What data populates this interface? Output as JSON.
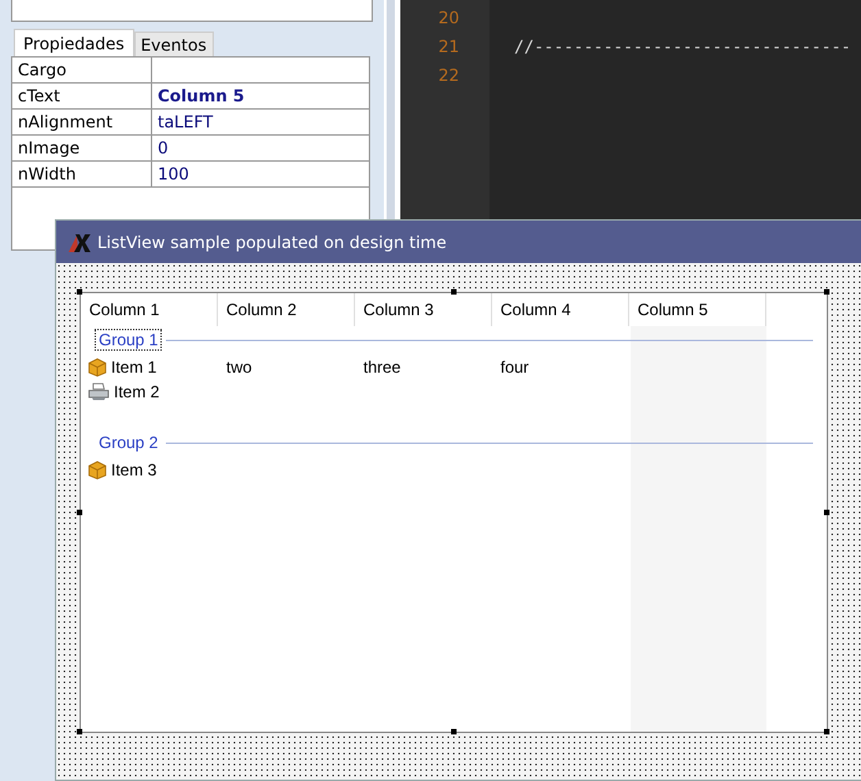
{
  "property_tabs": [
    {
      "label": "Propiedades",
      "selected": true
    },
    {
      "label": "Eventos",
      "selected": false
    }
  ],
  "properties": [
    {
      "name": "Cargo"
    },
    {
      "name": "cText",
      "value": "Column 5",
      "modified": true
    },
    {
      "name": "nAlignment",
      "value": "taLEFT",
      "modified": false
    },
    {
      "name": "nImage",
      "value": "0",
      "modified": false
    },
    {
      "name": "nWidth",
      "value": "100",
      "modified": false
    }
  ],
  "editor": {
    "lines": [
      {
        "number": "20"
      },
      {
        "number": "21",
        "code": "//--------------------------------"
      },
      {
        "number": "22"
      }
    ]
  },
  "form": {
    "title": "ListView sample populated on design time",
    "listview": {
      "columns": [
        "Column 1",
        "Column 2",
        "Column 3",
        "Column 4",
        "Column 5"
      ],
      "groups": [
        {
          "label": "Group 1",
          "selected": true,
          "items": [
            {
              "kind": "box",
              "cells": [
                "Item 1",
                "two",
                "three",
                "four"
              ]
            },
            {
              "kind": "printer",
              "cells": [
                "Item 2"
              ]
            }
          ]
        },
        {
          "label": "Group 2",
          "selected": false,
          "items": [
            {
              "kind": "box",
              "cells": [
                "Item 3"
              ]
            }
          ]
        }
      ]
    }
  }
}
